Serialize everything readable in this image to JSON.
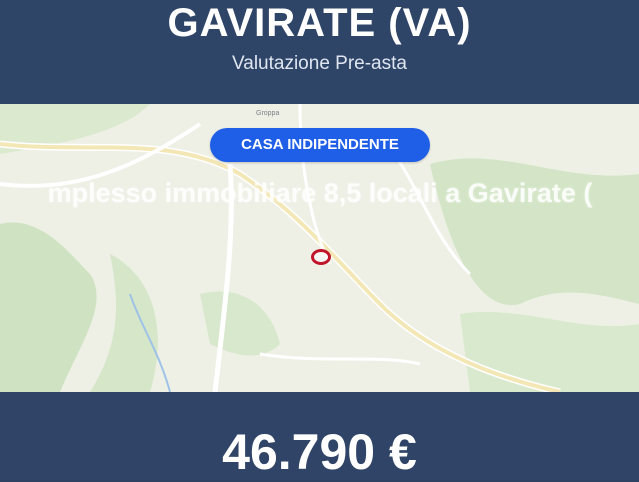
{
  "header": {
    "title": "GAVIRATE (VA)",
    "subtitle": "Valutazione Pre-asta"
  },
  "property": {
    "category_badge": "CASA INDIPENDENTE",
    "description": "mplesso immobiliare 8,5 locali a Gavirate (",
    "price": "46.790 €"
  },
  "map": {
    "place_label": "Groppa",
    "marker_icon": "location-marker-icon",
    "marker_color": "#c0152a"
  },
  "colors": {
    "header_bg": "#2f4568",
    "badge_bg": "#1f5fe8",
    "text": "#ffffff"
  }
}
